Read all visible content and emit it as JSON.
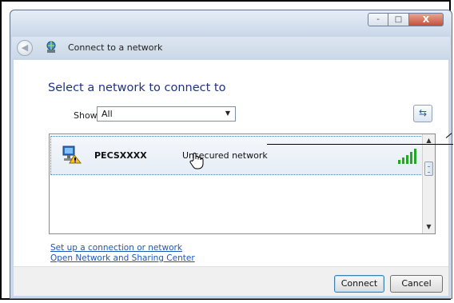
{
  "window": {
    "title": "Connect to a network",
    "controls": {
      "minimize": "-",
      "maximize": "□",
      "close": "X"
    }
  },
  "main": {
    "heading": "Select a network to connect to",
    "show_label": "Show",
    "show_select_value": "All",
    "refresh_icon": "refresh-icon"
  },
  "networks": [
    {
      "name": "PECSXXXX",
      "status": "Unsecured network",
      "icon": "unsecured-network-icon",
      "signal": "signal-bars-icon"
    }
  ],
  "links": {
    "setup": "Set up a connection or network",
    "sharing_center": "Open Network and Sharing Center"
  },
  "buttons": {
    "connect": "Connect",
    "cancel": "Cancel"
  },
  "colors": {
    "heading": "#1e3287",
    "link": "#1d57b8",
    "chrome": "#c9d7e7"
  }
}
